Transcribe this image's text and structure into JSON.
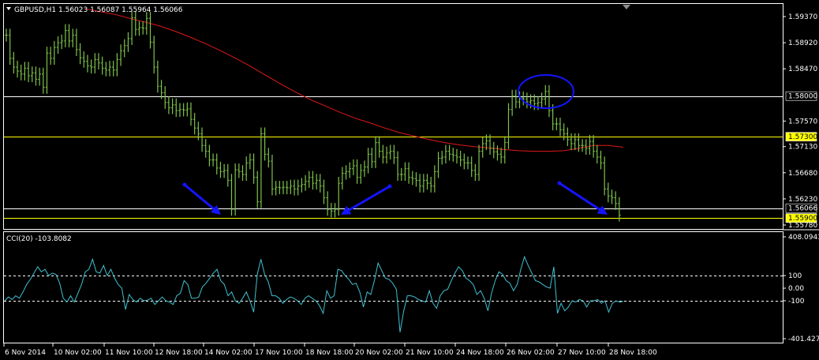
{
  "chart_data": [
    {
      "type": "line",
      "title": "GBPUSD,H1  1.56023 1.56087 1.55964 1.56066",
      "ylim": [
        1.5575,
        1.5955
      ],
      "y_ticks": [
        "1.59370",
        "1.58920",
        "1.58470",
        "1.57570",
        "1.57130",
        "1.56680",
        "1.56230",
        "1.55780"
      ],
      "hlines": [
        {
          "label": "1.58000",
          "value": 1.58,
          "color": "#ffffff"
        },
        {
          "label": "1.57300",
          "value": 1.573,
          "color": "#ffff00"
        },
        {
          "label": "1.55900",
          "value": 1.559,
          "color": "#ffff00"
        },
        {
          "label": "",
          "value": 1.5607,
          "color": "#ffffff"
        }
      ],
      "current_price_label": "1.56066",
      "series": [
        {
          "color": "#7fc24a",
          "values": [
            1.5905,
            1.5865,
            1.585,
            1.5843,
            1.5838,
            1.5848,
            1.5835,
            1.584,
            1.5829,
            1.5838,
            1.5815,
            1.5874,
            1.5865,
            1.5884,
            1.5892,
            1.5895,
            1.5913,
            1.5895,
            1.5905,
            1.588,
            1.5866,
            1.586,
            1.5852,
            1.585,
            1.5863,
            1.5857,
            1.5848,
            1.5845,
            1.585,
            1.5845,
            1.5863,
            1.5878,
            1.5887,
            1.5899,
            1.5935,
            1.5915,
            1.5918,
            1.5917,
            1.5934,
            1.5893,
            1.585,
            1.5817,
            1.5806,
            1.5789,
            1.578,
            1.5785,
            1.5775,
            1.5777,
            1.5776,
            1.5778,
            1.576,
            1.5745,
            1.5735,
            1.5715,
            1.5705,
            1.569,
            1.569,
            1.5676,
            1.567,
            1.5672,
            1.5655,
            1.5605,
            1.5673,
            1.567,
            1.5665,
            1.5685,
            1.569,
            1.566,
            1.5618,
            1.5735,
            1.57,
            1.5688,
            1.564,
            1.5643,
            1.5642,
            1.5643,
            1.5642,
            1.5645,
            1.564,
            1.5645,
            1.5648,
            1.5653,
            1.566,
            1.565,
            1.5655,
            1.5645,
            1.5625,
            1.5605,
            1.5602,
            1.5605,
            1.565,
            1.5667,
            1.567,
            1.5675,
            1.568,
            1.566,
            1.5672,
            1.5678,
            1.57,
            1.5687,
            1.572,
            1.5705,
            1.5695,
            1.5702,
            1.5705,
            1.5694,
            1.5665,
            1.5665,
            1.5675,
            1.566,
            1.5658,
            1.5655,
            1.5645,
            1.5655,
            1.565,
            1.5645,
            1.567,
            1.5693,
            1.5695,
            1.5705,
            1.57,
            1.5698,
            1.5695,
            1.569,
            1.5685,
            1.5685,
            1.5672,
            1.5665,
            1.5705,
            1.5718,
            1.5723,
            1.571,
            1.5704,
            1.57,
            1.5695,
            1.572,
            1.5777,
            1.58,
            1.579,
            1.5797,
            1.5795,
            1.579,
            1.5792,
            1.5787,
            1.5789,
            1.5795,
            1.5808,
            1.5775,
            1.5752,
            1.5752,
            1.5742,
            1.5735,
            1.5725,
            1.5718,
            1.5725,
            1.5715,
            1.5715,
            1.571,
            1.5722,
            1.5705,
            1.5695,
            1.5685,
            1.564,
            1.5628,
            1.5625,
            1.5615,
            1.5595
          ]
        },
        {
          "color": "#e01818",
          "values": [
            1.595,
            1.5945,
            1.594,
            1.5933,
            1.5927,
            1.592,
            1.5911,
            1.5901,
            1.589,
            1.5878,
            1.5865,
            1.5851,
            1.5836,
            1.5821,
            1.5807,
            1.5794,
            1.5783,
            1.5772,
            1.5762,
            1.5754,
            1.5745,
            1.5737,
            1.5731,
            1.5725,
            1.572,
            1.5716,
            1.5713,
            1.5711,
            1.5708,
            1.5706,
            1.5705,
            1.5705,
            1.5706,
            1.571,
            1.5715,
            1.5715,
            1.5712
          ]
        }
      ],
      "annotations": [
        {
          "type": "arrow",
          "direction": "down-right",
          "color": "#1414ff"
        },
        {
          "type": "arrow",
          "direction": "down-left",
          "color": "#1414ff"
        },
        {
          "type": "arrow",
          "direction": "down-right",
          "color": "#1414ff"
        },
        {
          "type": "ellipse",
          "color": "#1414ff"
        }
      ]
    },
    {
      "type": "line",
      "title": "CCI(20) -103.8082",
      "ylim": [
        -401.4278,
        408.0943
      ],
      "y_ticks": [
        "408.0943",
        "100",
        "0.00",
        "-100",
        "-401.4278"
      ],
      "levels": [
        100,
        -100
      ],
      "series": [
        {
          "color": "#40c0d0",
          "values": [
            -100,
            -70,
            -90,
            -60,
            -80,
            -30,
            30,
            70,
            120,
            170,
            130,
            150,
            100,
            120,
            110,
            40,
            -80,
            -110,
            -60,
            -110,
            -40,
            30,
            130,
            150,
            230,
            130,
            120,
            180,
            100,
            150,
            80,
            30,
            0,
            -170,
            -50,
            -90,
            -110,
            -80,
            -100,
            -95,
            -80,
            -130,
            -100,
            -70,
            -100,
            -110,
            -130,
            -60,
            -40,
            60,
            30,
            -80,
            -80,
            -70,
            10,
            40,
            80,
            120,
            150,
            60,
            30,
            -60,
            -30,
            -100,
            -120,
            -80,
            -30,
            -100,
            -190,
            110,
            230,
            110,
            50,
            -60,
            -60,
            -80,
            -120,
            -90,
            -70,
            -80,
            -100,
            -130,
            -80,
            -60,
            -80,
            -100,
            -140,
            -200,
            -20,
            -80,
            -60,
            150,
            140,
            100,
            70,
            30,
            40,
            -30,
            -150,
            -30,
            -50,
            60,
            200,
            140,
            80,
            70,
            40,
            -10,
            -350,
            -180,
            -60,
            -60,
            -70,
            -90,
            -100,
            -110,
            -20,
            -120,
            -160,
            -60,
            -20,
            -10,
            60,
            120,
            170,
            140,
            80,
            60,
            30,
            -50,
            -20,
            -80,
            -180,
            -40,
            60,
            130,
            110,
            60,
            40,
            -20,
            30,
            150,
            250,
            180,
            120,
            60,
            50,
            30,
            10,
            0,
            170,
            -200,
            -120,
            -180,
            -150,
            -100,
            -110,
            -90,
            -100,
            -150,
            -100,
            -100,
            -90,
            -120,
            -100,
            -190,
            -120,
            -100,
            -110,
            -104
          ]
        }
      ]
    }
  ],
  "x_labels": [
    "6 Nov 2014",
    "10 Nov 02:00",
    "11 Nov 10:00",
    "12 Nov 18:00",
    "14 Nov 02:00",
    "17 Nov 10:00",
    "18 Nov 18:00",
    "20 Nov 02:00",
    "21 Nov 10:00",
    "24 Nov 18:00",
    "26 Nov 02:00",
    "27 Nov 10:00",
    "28 Nov 18:00"
  ],
  "colors": {
    "background": "#000000",
    "grid": "#ffffff",
    "price_bars": "#7fc24a",
    "moving_average": "#e01818",
    "cci_line": "#40c0d0",
    "annotation": "#1414ff",
    "highlight_label": "#ffff00"
  },
  "icons": {
    "menu": "triangle-down-icon",
    "scroll": "triangle-down-icon"
  }
}
